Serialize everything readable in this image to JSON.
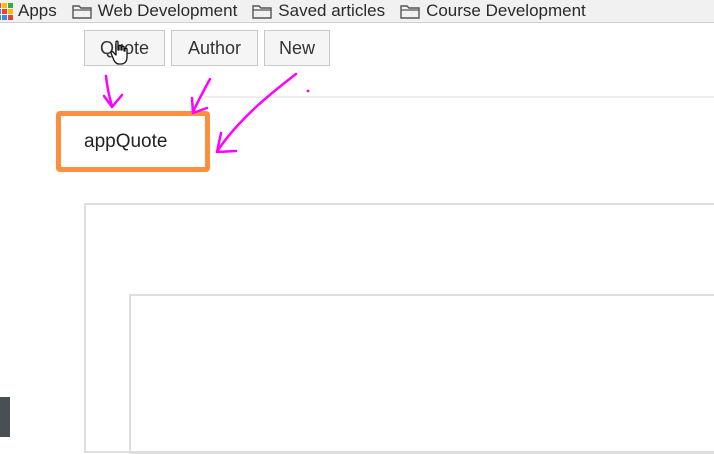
{
  "bookmarks": {
    "apps_label": "Apps",
    "folders": [
      {
        "label": "Web Development"
      },
      {
        "label": "Saved articles"
      },
      {
        "label": "Course Development"
      }
    ]
  },
  "buttons": {
    "quote": "Quote",
    "author": "Author",
    "new": "New"
  },
  "component": {
    "label": "appQuote"
  },
  "colors": {
    "highlight": "#ff8f3f",
    "annotation": "#ff00ff"
  },
  "icons": {
    "apps": "apps-grid-icon",
    "folder": "folder-icon",
    "cursor": "hand-pointer-icon"
  }
}
